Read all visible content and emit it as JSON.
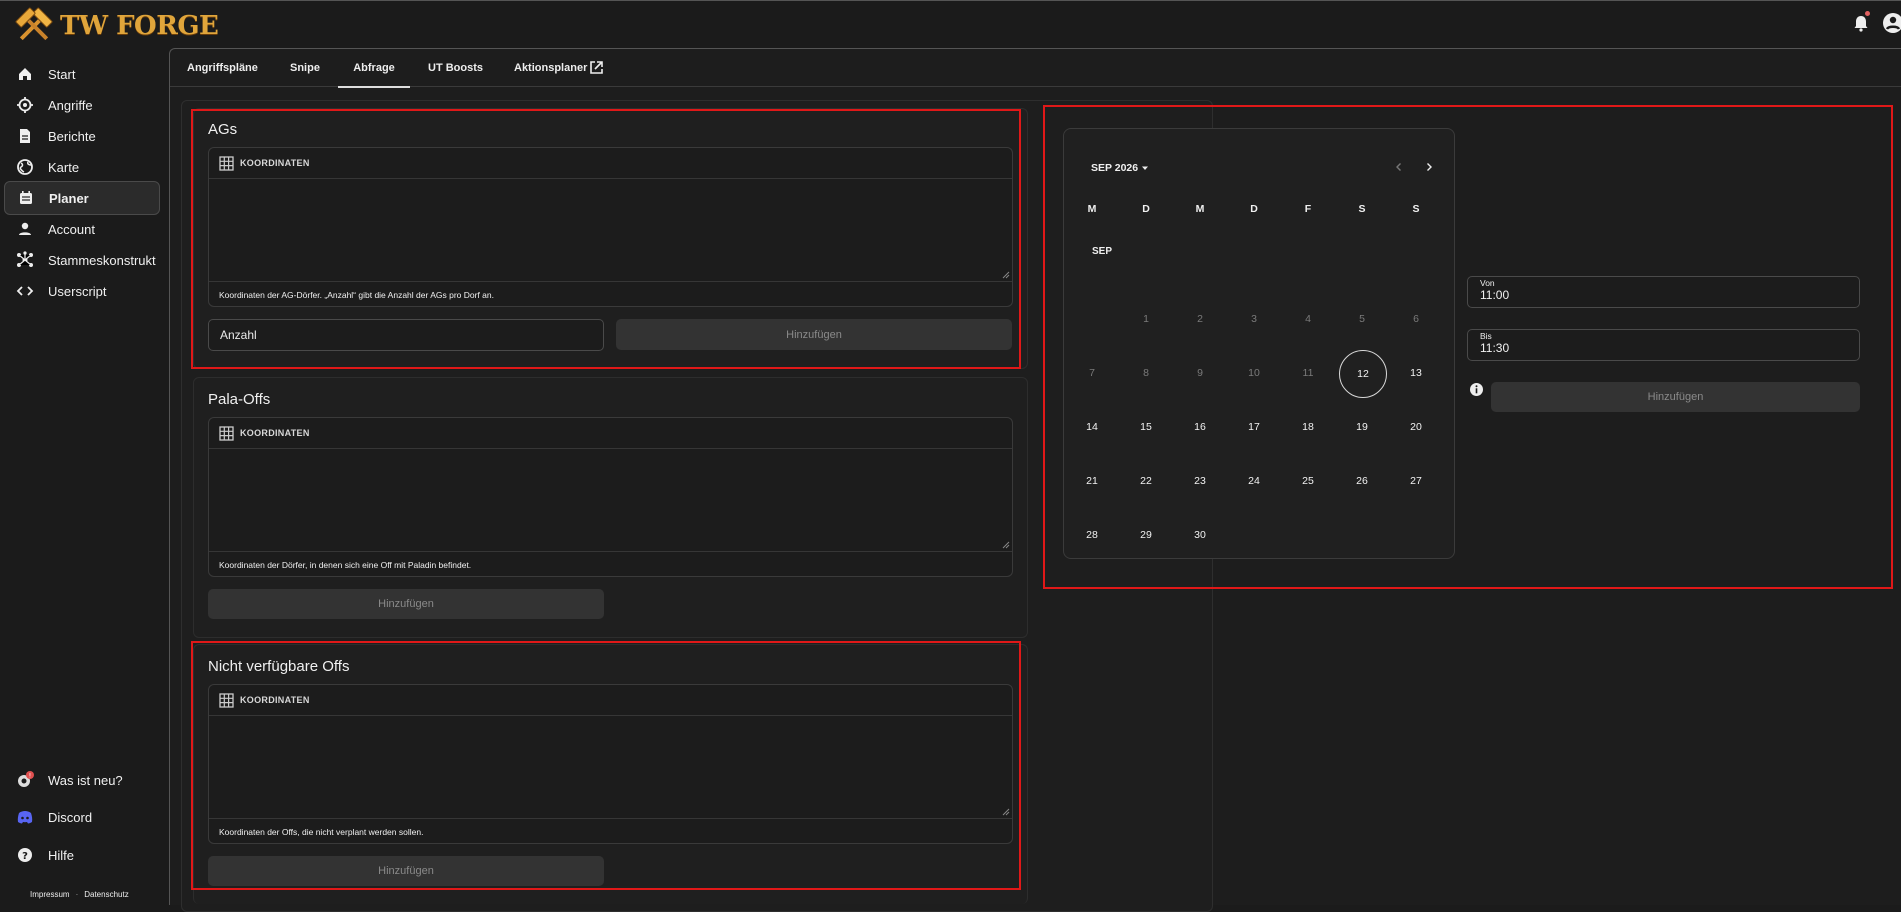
{
  "app": {
    "logo_text": "TW FORGE"
  },
  "sidebar": {
    "items": [
      {
        "label": "Start",
        "icon": "home-icon"
      },
      {
        "label": "Angriffe",
        "icon": "target-icon"
      },
      {
        "label": "Berichte",
        "icon": "document-icon"
      },
      {
        "label": "Karte",
        "icon": "globe-icon"
      },
      {
        "label": "Planer",
        "icon": "calendar-icon",
        "active": true
      },
      {
        "label": "Account",
        "icon": "person-icon"
      },
      {
        "label": "Stammeskonstrukt",
        "icon": "network-icon"
      },
      {
        "label": "Userscript",
        "icon": "code-icon"
      }
    ],
    "bottom_items": [
      {
        "label": "Was ist neu?",
        "icon": "whats-new-icon",
        "badge": "!"
      },
      {
        "label": "Discord",
        "icon": "discord-icon"
      },
      {
        "label": "Hilfe",
        "icon": "help-icon"
      }
    ],
    "footer": {
      "impressum": "Impressum",
      "sep": "·",
      "datenschutz": "Datenschutz"
    }
  },
  "tabs": [
    {
      "label": "Angriffspläne"
    },
    {
      "label": "Snipe"
    },
    {
      "label": "Abfrage",
      "active": true
    },
    {
      "label": "UT Boosts"
    },
    {
      "label": "Aktionsplaner",
      "external": true
    }
  ],
  "ags": {
    "title": "AGs",
    "coord_header": "KOORDINATEN",
    "hint": "Koordinaten der AG-Dörfer. „Anzahl“ gibt die Anzahl der AGs pro Dorf an.",
    "count_placeholder": "Anzahl",
    "add_label": "Hinzufügen"
  },
  "pala": {
    "title": "Pala-Offs",
    "coord_header": "KOORDINATEN",
    "hint": "Koordinaten der Dörfer, in denen sich eine Off mit Paladin befindet.",
    "add_label": "Hinzufügen"
  },
  "unavailable": {
    "title": "Nicht verfügbare Offs",
    "coord_header": "KOORDINATEN",
    "hint": "Koordinaten der Offs, die nicht verplant werden sollen.",
    "add_label": "Hinzufügen"
  },
  "calendar": {
    "month_label": "SEP 2026",
    "weekdays": [
      "M",
      "D",
      "M",
      "D",
      "F",
      "S",
      "S"
    ],
    "month_short": "SEP",
    "weeks": [
      [
        "",
        "1",
        "2",
        "3",
        "4",
        "5",
        "6"
      ],
      [
        "7",
        "8",
        "9",
        "10",
        "11",
        "12",
        "13"
      ],
      [
        "14",
        "15",
        "16",
        "17",
        "18",
        "19",
        "20"
      ],
      [
        "21",
        "22",
        "23",
        "24",
        "25",
        "26",
        "27"
      ],
      [
        "28",
        "29",
        "30",
        "",
        "",
        "",
        ""
      ]
    ],
    "disabled_days": [
      "1",
      "2",
      "3",
      "4",
      "5",
      "6",
      "7",
      "8",
      "9",
      "10",
      "11"
    ],
    "selected_day": "12"
  },
  "time": {
    "from_label": "Von",
    "from_value": "11:00",
    "to_label": "Bis",
    "to_value": "11:30",
    "add_label": "Hinzufügen"
  }
}
